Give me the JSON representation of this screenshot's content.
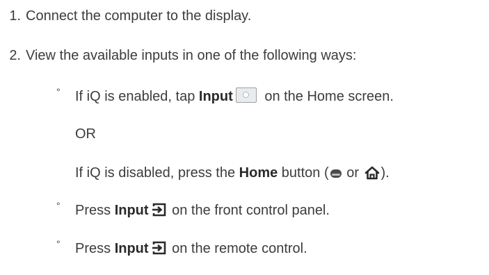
{
  "steps": [
    {
      "number": "1.",
      "text": "Connect the computer to the display."
    },
    {
      "number": "2.",
      "text": "View the available inputs in one of the following ways:"
    }
  ],
  "options": {
    "bullet": "°",
    "iq_enabled": {
      "before": "If iQ is enabled, tap ",
      "bold": "Input",
      "after": " on the Home screen.",
      "icon": "input-tile-icon"
    },
    "or": "OR",
    "iq_disabled": {
      "before": "If iQ is disabled, press the ",
      "bold": "Home",
      "middle": " button (",
      "or_word": " or ",
      "end": ").",
      "icons": [
        "home-pill-icon",
        "home-outline-icon"
      ]
    },
    "front_panel": {
      "before": "Press ",
      "bold": "Input",
      "after": " on the front control panel.",
      "icon": "input-arrow-icon"
    },
    "remote": {
      "before": "Press ",
      "bold": "Input",
      "after": " on the remote control.",
      "icon": "input-arrow-icon"
    }
  },
  "colors": {
    "text": "#3c3c3c",
    "icon": "#2a2a2a"
  }
}
